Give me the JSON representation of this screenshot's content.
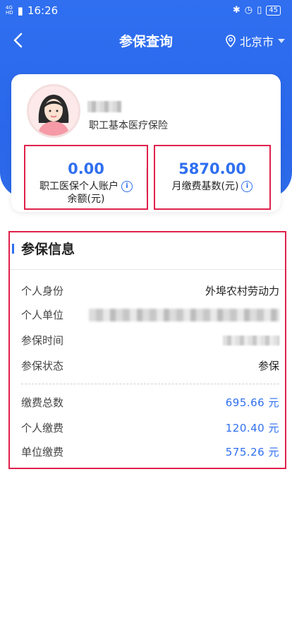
{
  "status_bar": {
    "network": "4G",
    "network_sub": "HD",
    "time": "16:26",
    "battery": "45"
  },
  "nav": {
    "title": "参保查询",
    "city": "北京市"
  },
  "profile": {
    "insurance_type": "职工基本医疗保险"
  },
  "stats": {
    "balance": {
      "value": "0.00",
      "label_line1": "职工医保个人账户",
      "label_line2": "余额(元)"
    },
    "base": {
      "value": "5870.00",
      "label": "月缴费基数(元)"
    }
  },
  "info": {
    "title": "参保信息",
    "rows": [
      {
        "key": "个人身份",
        "value": "外埠农村劳动力"
      },
      {
        "key": "个人单位",
        "value": ""
      },
      {
        "key": "参保时间",
        "value": ""
      },
      {
        "key": "参保状态",
        "value": "参保"
      }
    ],
    "payments": [
      {
        "key": "缴费总数",
        "value": "695.66 元"
      },
      {
        "key": "个人缴费",
        "value": "120.40 元"
      },
      {
        "key": "单位缴费",
        "value": "575.26 元"
      }
    ]
  },
  "colors": {
    "accent": "#2f6ff0",
    "highlight_border": "#e0214b"
  },
  "icons": {
    "back": "chevron-left-icon",
    "location": "location-pin-icon",
    "dropdown": "caret-down-icon",
    "info": "info-circle-icon"
  }
}
